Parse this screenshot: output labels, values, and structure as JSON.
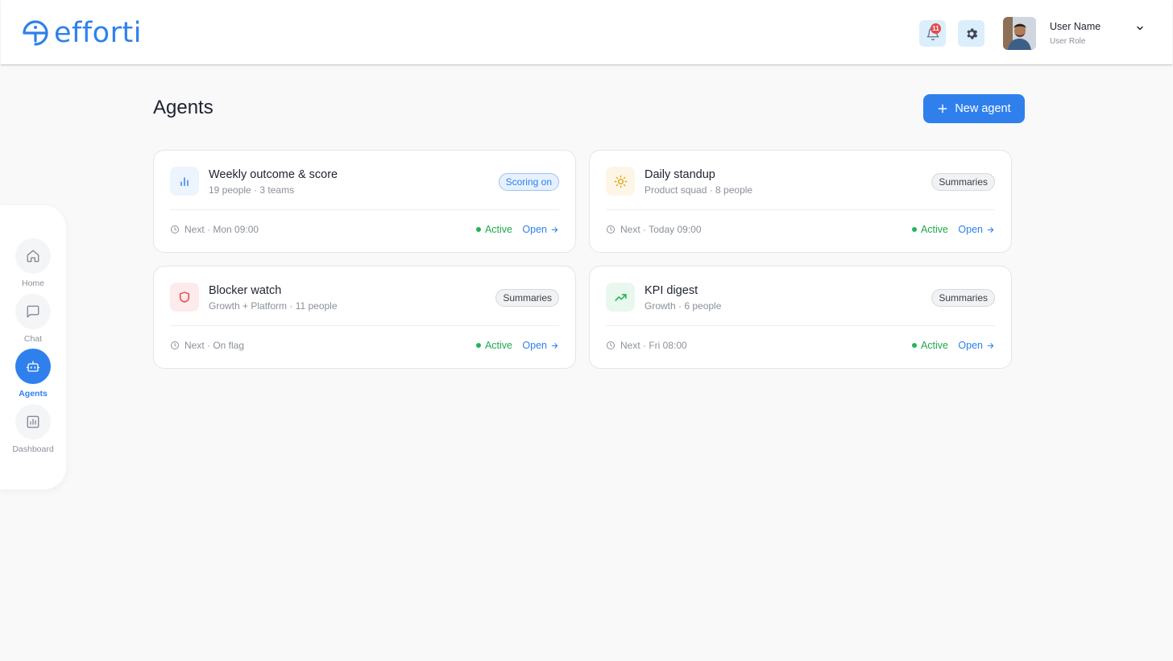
{
  "brand": {
    "name": "efforti",
    "color": "#2f80ed"
  },
  "header": {
    "notification_count": "11",
    "user": {
      "name": "User Name",
      "role": "User Role"
    }
  },
  "sidebar": {
    "items": [
      {
        "label": "Home",
        "icon": "home-icon",
        "active": false
      },
      {
        "label": "Chat",
        "icon": "chat-icon",
        "active": false
      },
      {
        "label": "Agents",
        "icon": "robot-icon",
        "active": true
      },
      {
        "label": "Dashboard",
        "icon": "bar-chart-icon",
        "active": false
      }
    ]
  },
  "main": {
    "title": "Agents",
    "new_agent_label": "New agent",
    "cards": [
      {
        "title": "Weekly outcome & score",
        "subtitle": "19 people · 3 teams",
        "tag": "Scoring on",
        "icon": "bar-chart-icon",
        "icon_color": "#2f80ed",
        "next": "Next · Mon 09:00",
        "status": "Active",
        "open_label": "Open"
      },
      {
        "title": "Daily standup",
        "subtitle": "Product squad · 8 people",
        "tag": "Summaries",
        "icon": "sun-icon",
        "icon_color": "#e2a21b",
        "next": "Next · Today 09:00",
        "status": "Active",
        "open_label": "Open"
      },
      {
        "title": "Blocker watch",
        "subtitle": "Growth + Platform · 11 people",
        "tag": "Summaries",
        "icon": "shield-icon",
        "icon_color": "#e5484d",
        "next": "Next · On flag",
        "status": "Active",
        "open_label": "Open"
      },
      {
        "title": "KPI digest",
        "subtitle": "Growth · 6 people",
        "tag": "Summaries",
        "icon": "trending-up-icon",
        "icon_color": "#22b455",
        "next": "Next · Fri 08:00",
        "status": "Active",
        "open_label": "Open"
      }
    ]
  },
  "colors": {
    "accent": "#2f80ed",
    "active_status": "#1fa94c",
    "notification_badge": "#e5484d"
  }
}
